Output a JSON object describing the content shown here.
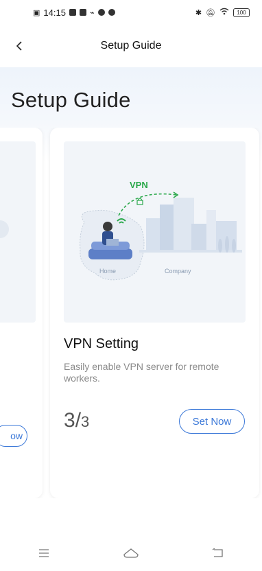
{
  "status_bar": {
    "time": "14:15",
    "battery": "100"
  },
  "header": {
    "title": "Setup Guide",
    "back_icon": "chevron-left-icon"
  },
  "hero": {
    "title": "Setup Guide"
  },
  "carousel": {
    "previous_card": {
      "button_label_partial": "ow"
    },
    "current_card": {
      "illustration": {
        "vpn_label": "VPN",
        "home_label": "Home",
        "company_label": "Company"
      },
      "title": "VPN Setting",
      "description": "Easily enable VPN server for remote workers.",
      "page_current": "3",
      "page_separator": "/",
      "page_total": "3",
      "button_label": "Set Now"
    }
  },
  "colors": {
    "accent": "#3b78d8",
    "vpn_green": "#2aa84a",
    "hero_bg": "#eef4fb"
  },
  "system_nav": {
    "icons": [
      "menu-icon",
      "home-icon",
      "back-icon"
    ]
  }
}
